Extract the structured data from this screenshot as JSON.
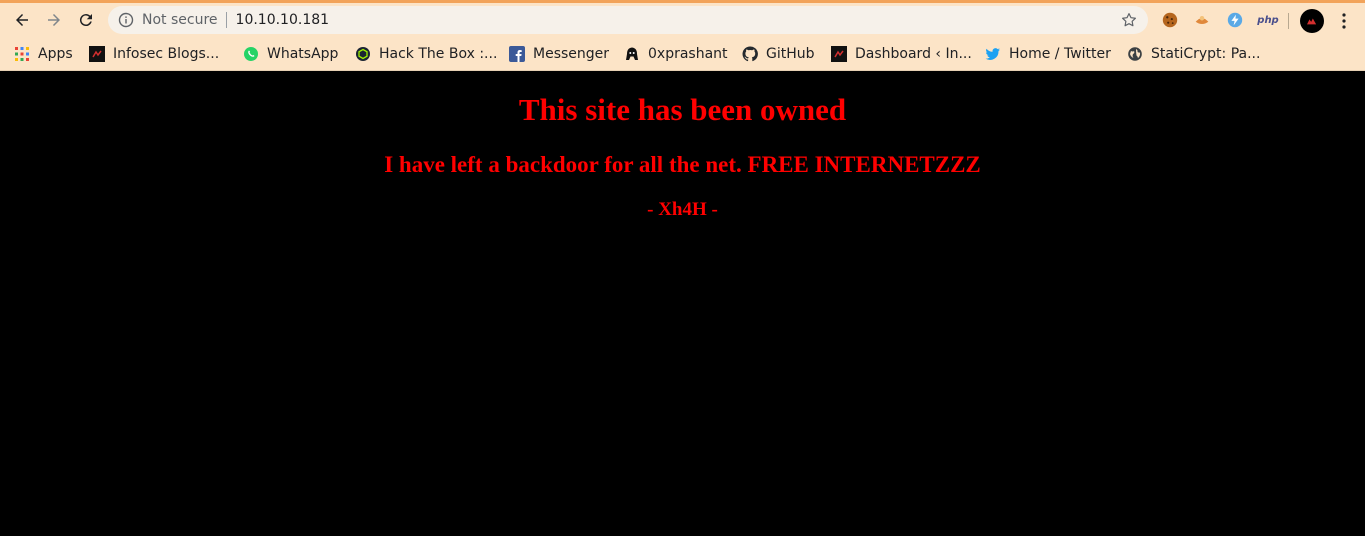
{
  "browser": {
    "not_secure_label": "Not secure",
    "url": "10.10.10.181",
    "ext_php_label": "php",
    "accent_color": "#fce4c7"
  },
  "bookmarks": {
    "apps": "Apps",
    "infosec": "Infosec Blogs...",
    "whatsapp": "WhatsApp",
    "htb": "Hack The Box :...",
    "messenger": "Messenger",
    "oxprashant": "0xprashant",
    "github": "GitHub",
    "dashboard": "Dashboard ‹ In...",
    "twitter": "Home / Twitter",
    "staticrypt": "StatiCrypt: Pa..."
  },
  "page": {
    "heading": "This site has been owned",
    "message": "I have left a backdoor for all the net. FREE INTERNETZZZ",
    "signature": "- Xh4H -",
    "text_color": "#ff0000",
    "background_color": "#000000"
  }
}
